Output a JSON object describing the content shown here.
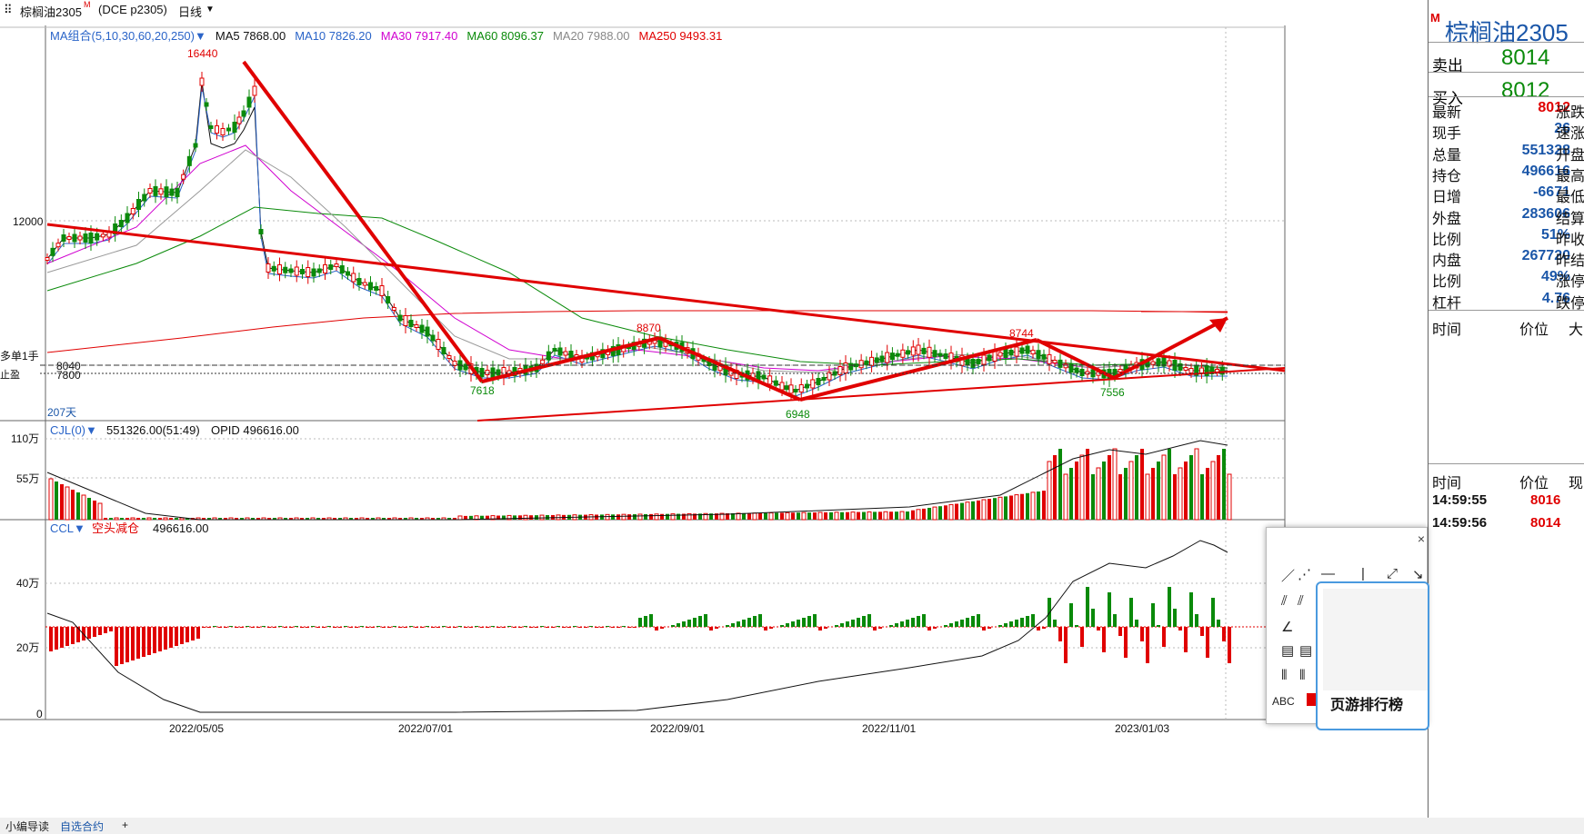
{
  "header": {
    "symbol": "棕榈油2305",
    "superscript": "M",
    "subtitle": "(DCE p2305)",
    "period": "日线",
    "period_arrow": "▼"
  },
  "ma_legend": [
    {
      "text": "MA组合(5,10,30,60,20,250)▼",
      "color": "#2a64c8"
    },
    {
      "text": "MA5 7868.00",
      "color": "#111111"
    },
    {
      "text": "MA10 7826.20",
      "color": "#2a64c8"
    },
    {
      "text": "MA30 7917.40",
      "color": "#d000d0"
    },
    {
      "text": "MA60 8096.37",
      "color": "#0a8a0a"
    },
    {
      "text": "MA20 7988.00",
      "color": "#888888"
    },
    {
      "text": "MA250 9493.31",
      "color": "#e00000"
    }
  ],
  "price_panel": {
    "annotations": {
      "high": "16440",
      "p8870": "8870",
      "p8744": "8744",
      "p7618": "7618",
      "p6948": "6948",
      "p7556": "7556"
    },
    "y_labels": [
      "12000",
      "8040",
      "7800"
    ],
    "left_labels": [
      "多单1手",
      "止盈",
      "207天"
    ]
  },
  "volume_panel": {
    "title": "CJL(0)▼",
    "value": "551326.00(51:49)",
    "opid": "OPID 496616.00",
    "y_labels": [
      "110万",
      "55万"
    ]
  },
  "oi_panel": {
    "title": "CCL▼",
    "tag": "空头减仓",
    "value": "496616.00",
    "y_labels": [
      "40万",
      "20万",
      "0"
    ]
  },
  "x_labels": [
    "2022/05/05",
    "2022/07/01",
    "2022/09/01",
    "2022/11/01",
    "2023/01/03"
  ],
  "quote": {
    "code": "棕榈油2305",
    "m": "M",
    "sell_label": "卖出",
    "sell": "8014",
    "buy_label": "买入",
    "buy": "8012",
    "rows": [
      {
        "label": "最新",
        "value": "8012",
        "color": "#e00000",
        "right": "涨跌"
      },
      {
        "label": "现手",
        "value": "26",
        "color": "#1a56a8",
        "right": "速涨"
      },
      {
        "label": "总量",
        "value": "551328",
        "color": "#1a56a8",
        "right": "开盘"
      },
      {
        "label": "持仓",
        "value": "496616",
        "color": "#1a56a8",
        "right": "最高"
      },
      {
        "label": "日增",
        "value": "-6671",
        "color": "#1a56a8",
        "right": "最低"
      },
      {
        "label": "外盘",
        "value": "283606",
        "color": "#1a56a8",
        "right": "结算"
      },
      {
        "label": "比例",
        "value": "51%",
        "color": "#1a56a8",
        "right": "昨收"
      },
      {
        "label": "内盘",
        "value": "267720",
        "color": "#1a56a8",
        "right": "昨结"
      },
      {
        "label": "比例",
        "value": "49%",
        "color": "#1a56a8",
        "right": "涨停"
      },
      {
        "label": "杠杆",
        "value": "4.76",
        "color": "#1a56a8",
        "right": "跌停"
      }
    ],
    "time_header": "时间",
    "price_header": "价位",
    "extra_header": "大",
    "time_header2": "时间",
    "price_header2": "价位",
    "extra_header2": "现",
    "ticks": [
      {
        "time": "14:59:55",
        "price": "8016"
      },
      {
        "time": "14:59:56",
        "price": "8014"
      }
    ]
  },
  "popup": {
    "close": "×",
    "abc": "ABC",
    "card_caption": "页游排行榜"
  },
  "bottom": {
    "item1": "小编导读",
    "item2": "自选合约",
    "plus": "+"
  },
  "chart_data": [
    {
      "type": "candlestick",
      "title": "棕榈油2305 日线",
      "annotations": [
        {
          "label": "16440",
          "x": "2022/05/05"
        },
        {
          "label": "7618",
          "x": "2022/07/01"
        },
        {
          "label": "8870",
          "x": "2022/08"
        },
        {
          "label": "6948",
          "x": "2022/10"
        },
        {
          "label": "8744",
          "x": "2022/12"
        },
        {
          "label": "7556",
          "x": "2023/01"
        }
      ],
      "ma": {
        "MA5": 7868.0,
        "MA10": 7826.2,
        "MA30": 7917.4,
        "MA60": 8096.37,
        "MA20": 7988.0,
        "MA250": 9493.31
      },
      "y_ticks": [
        12000,
        8040,
        7800
      ]
    },
    {
      "type": "bar",
      "title": "CJL(0)",
      "value": 551326.0,
      "y_ticks": [
        "110万",
        "55万"
      ]
    },
    {
      "type": "bar",
      "title": "CCL",
      "value": 496616.0,
      "y_ticks": [
        "40万",
        "20万",
        "0"
      ]
    }
  ]
}
